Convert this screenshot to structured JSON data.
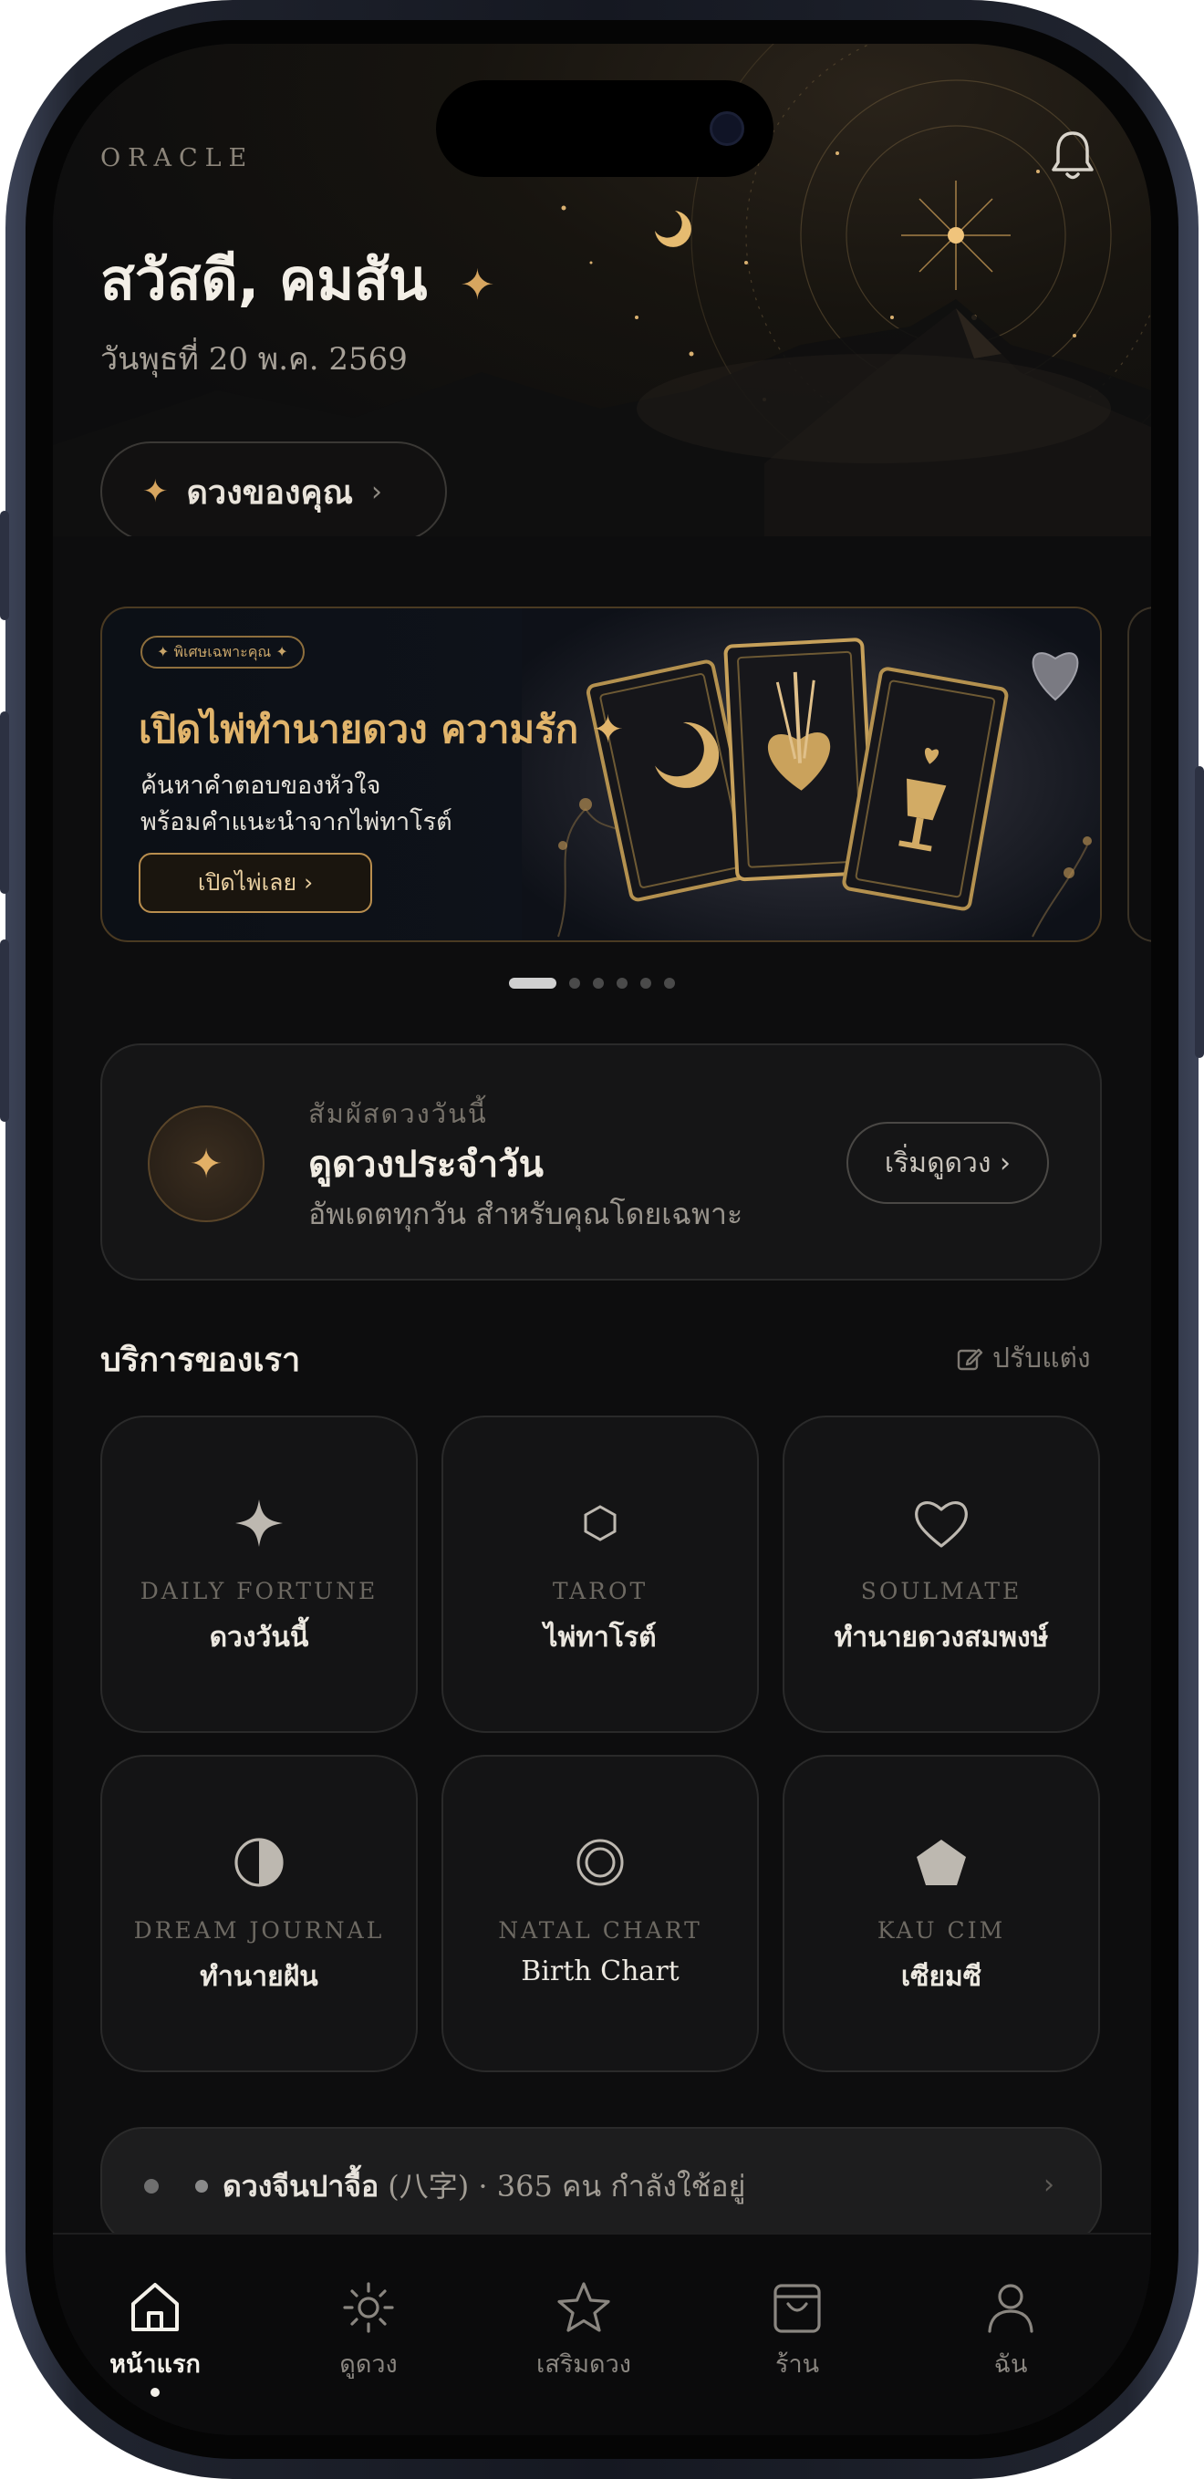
{
  "brand": "ORACLE",
  "greeting": "สวัสดี, คมสัน",
  "greeting_sparkle": "✦",
  "date": "วันพุธที่ 20 พ.ค. 2569",
  "horoscope_pill": {
    "icon": "✦",
    "label": "ดวงของคุณ",
    "chevron": "›"
  },
  "banner": {
    "badge": "✦ พิเศษเฉพาะคุณ ✦",
    "title": "เปิดไพ่ทำนายดวง ความรัก ✦",
    "subtitle_line1": "ค้นหาคำตอบของหัวใจ",
    "subtitle_line2": "พร้อมคำแนะนำจากไพ่ทาโรต์",
    "cta": "เปิดไพ่เลย ›",
    "slide_count": 6,
    "active_slide": 1
  },
  "daily": {
    "icon": "✦",
    "kicker": "สัมผัสดวงวันนี้",
    "title": "ดูดวงประจำวัน",
    "description": "อัพเดตทุกวัน สำหรับคุณโดยเฉพาะ",
    "button": "เริ่มดูดวง ›"
  },
  "services": {
    "title": "บริการของเรา",
    "edit_label": "ปรับแต่ง",
    "items": [
      {
        "en": "DAILY FORTUNE",
        "th": "ดวงวันนี้",
        "icon": "sparkle-icon"
      },
      {
        "en": "TAROT",
        "th": "ไพ่ทาโรต์",
        "icon": "hexagon-icon"
      },
      {
        "en": "SOULMATE",
        "th": "ทำนายดวงสมพงษ์",
        "icon": "heart-icon"
      },
      {
        "en": "DREAM JOURNAL",
        "th": "ทำนายฝัน",
        "icon": "half-moon-icon"
      },
      {
        "en": "NATAL CHART",
        "th": "Birth Chart",
        "icon": "concentric-circle-icon"
      },
      {
        "en": "KAU CIM",
        "th": "เซียมซี",
        "icon": "pentagon-icon"
      }
    ]
  },
  "announcement": {
    "bold": "ดวงจีนปาจื้อ",
    "rest": "(八字) · 365 คน กำลังใช้อยู่",
    "chevron": "›"
  },
  "tabs": [
    {
      "label": "หน้าแรก",
      "icon": "home-icon",
      "active": true
    },
    {
      "label": "ดูดวง",
      "icon": "sun-icon",
      "active": false
    },
    {
      "label": "เสริมดวง",
      "icon": "star-icon",
      "active": false
    },
    {
      "label": "ร้าน",
      "icon": "shopping-bag-icon",
      "active": false
    },
    {
      "label": "ฉัน",
      "icon": "user-icon",
      "active": false
    }
  ],
  "colors": {
    "gold": "#d6a55f",
    "background": "#0d0d0e",
    "card": "#151516"
  }
}
